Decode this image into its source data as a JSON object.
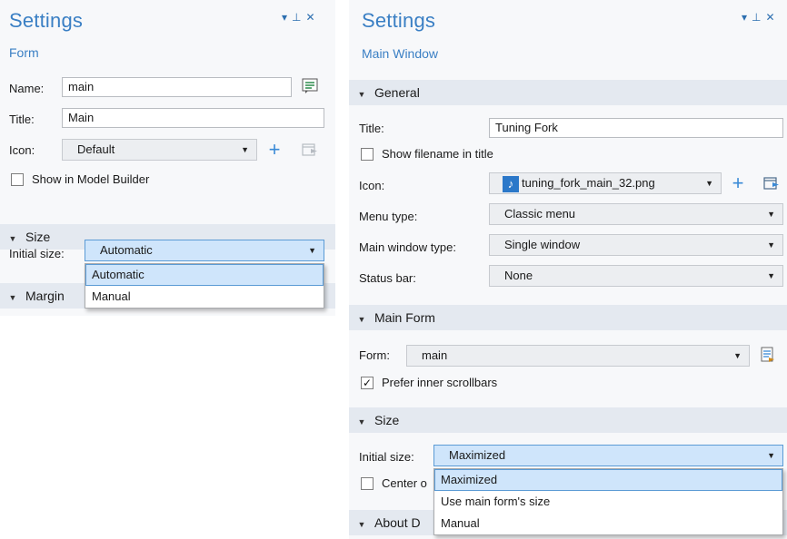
{
  "window_controls": {
    "dropdown": "▾",
    "pin": "⊥",
    "close": "✕"
  },
  "left": {
    "title": "Settings",
    "subtitle": "Form",
    "name_label": "Name:",
    "name_value": "main",
    "title_label": "Title:",
    "title_value": "Main",
    "icon_label": "Icon:",
    "icon_value": "Default",
    "show_in_model_builder": "Show in Model Builder",
    "section_size": "Size",
    "initial_size_label": "Initial size:",
    "initial_size_value": "Automatic",
    "section_margins": "Margin",
    "dropdown_options": [
      "Automatic",
      "Manual"
    ]
  },
  "right": {
    "title": "Settings",
    "subtitle": "Main Window",
    "section_general": "General",
    "title_label": "Title:",
    "title_value": "Tuning Fork",
    "show_filename": "Show filename in title",
    "icon_label": "Icon:",
    "icon_value": "tuning_fork_main_32.png",
    "menu_type_label": "Menu type:",
    "menu_type_value": "Classic menu",
    "main_window_type_label": "Main window type:",
    "main_window_type_value": "Single window",
    "status_bar_label": "Status bar:",
    "status_bar_value": "None",
    "section_main_form": "Main Form",
    "form_label": "Form:",
    "form_value": "main",
    "prefer_inner_scrollbars": "Prefer inner scrollbars",
    "prefer_inner_checked": true,
    "section_size": "Size",
    "initial_size_label": "Initial size:",
    "initial_size_value": "Maximized",
    "center_label": "Center o",
    "section_about": "About D",
    "dropdown_options": [
      "Maximized",
      "Use main form's size",
      "Manual"
    ]
  },
  "colors": {
    "accent": "#3a7fc4",
    "section_bg": "#e4e9f0",
    "selected_bg": "#cfe5fb",
    "selected_border": "#5b9bd5"
  }
}
